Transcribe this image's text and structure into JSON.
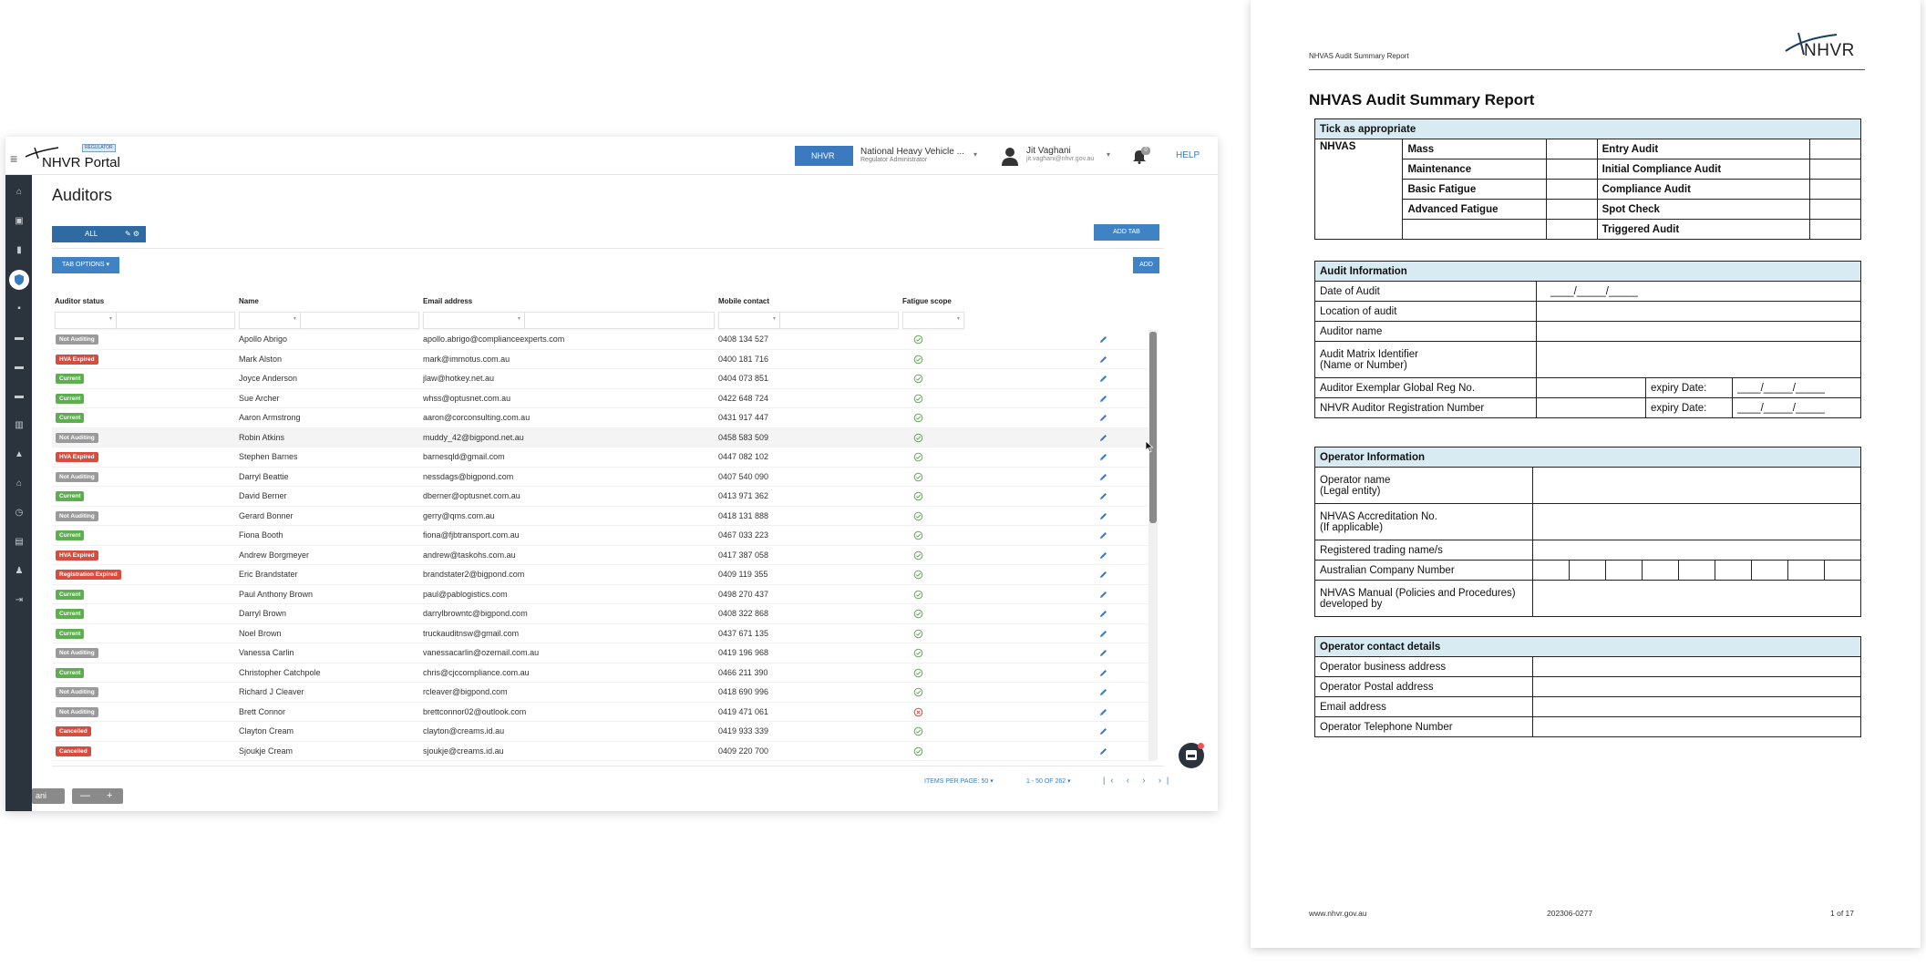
{
  "app": {
    "logo_text": "NHVR Portal",
    "logo_badge": "REGULATOR",
    "org_name": "National Heavy Vehicle ...",
    "org_role": "Regulator Administrator",
    "org_logo_text": "NHVR",
    "user_name": "Jit Vaghani",
    "user_email": "jit.vaghani@nhvr.gov.au",
    "notification_count": "0",
    "help_label": "HELP"
  },
  "page": {
    "title": "Auditors",
    "tab_all_label": "ALL",
    "add_tab_label": "ADD TAB",
    "tab_options_label": "TAB OPTIONS ▾",
    "add_label": "ADD"
  },
  "table": {
    "columns": [
      "Auditor status",
      "Name",
      "Email address",
      "Mobile contact",
      "Fatigue scope"
    ],
    "rows": [
      {
        "status": "Not Auditing",
        "name": "Apollo Abrigo",
        "email": "apollo.abrigo@complianceexperts.com",
        "mobile": "0408 134 527",
        "fatigue": "ok"
      },
      {
        "status": "HVA Expired",
        "name": "Mark Alston",
        "email": "mark@immotus.com.au",
        "mobile": "0400 181 716",
        "fatigue": "ok"
      },
      {
        "status": "Current",
        "name": "Joyce Anderson",
        "email": "jlaw@hotkey.net.au",
        "mobile": "0404 073 851",
        "fatigue": "ok"
      },
      {
        "status": "Current",
        "name": "Sue Archer",
        "email": "whss@optusnet.com.au",
        "mobile": "0422 648 724",
        "fatigue": "ok"
      },
      {
        "status": "Current",
        "name": "Aaron Armstrong",
        "email": "aaron@corconsulting.com.au",
        "mobile": "0431 917 447",
        "fatigue": "ok"
      },
      {
        "status": "Not Auditing",
        "name": "Robin Atkins",
        "email": "muddy_42@bigpond.net.au",
        "mobile": "0458 583 509",
        "fatigue": "ok"
      },
      {
        "status": "HVA Expired",
        "name": "Stephen Barnes",
        "email": "barnesqld@gmail.com",
        "mobile": "0447 082 102",
        "fatigue": "ok"
      },
      {
        "status": "Not Auditing",
        "name": "Darryl Beattie",
        "email": "nessdags@bigpond.com",
        "mobile": "0407 540 090",
        "fatigue": "ok"
      },
      {
        "status": "Current",
        "name": "David Berner",
        "email": "dberner@optusnet.com.au",
        "mobile": "0413 971 362",
        "fatigue": "ok"
      },
      {
        "status": "Not Auditing",
        "name": "Gerard Bonner",
        "email": "gerry@qms.com.au",
        "mobile": "0418 131 888",
        "fatigue": "ok"
      },
      {
        "status": "Current",
        "name": "Fiona Booth",
        "email": "fiona@fjbtransport.com.au",
        "mobile": "0467 033 223",
        "fatigue": "ok"
      },
      {
        "status": "HVA Expired",
        "name": "Andrew Borgmeyer",
        "email": "andrew@taskohs.com.au",
        "mobile": "0417 387 058",
        "fatigue": "ok"
      },
      {
        "status": "Registration Expired",
        "name": "Eric Brandstater",
        "email": "brandstater2@bigpond.com",
        "mobile": "0409 119 355",
        "fatigue": "ok"
      },
      {
        "status": "Current",
        "name": "Paul Anthony Brown",
        "email": "paul@pablogistics.com",
        "mobile": "0498 270 437",
        "fatigue": "ok"
      },
      {
        "status": "Current",
        "name": "Darryl Brown",
        "email": "darrylbrowntc@bigpond.com",
        "mobile": "0408 322 868",
        "fatigue": "ok"
      },
      {
        "status": "Current",
        "name": "Noel Brown",
        "email": "truckauditnsw@gmail.com",
        "mobile": "0437 671 135",
        "fatigue": "ok"
      },
      {
        "status": "Not Auditing",
        "name": "Vanessa Carlin",
        "email": "vanessacarlin@ozemail.com.au",
        "mobile": "0419 196 968",
        "fatigue": "ok"
      },
      {
        "status": "Current",
        "name": "Christopher Catchpole",
        "email": "chris@cjccompliance.com.au",
        "mobile": "0466 211 390",
        "fatigue": "ok"
      },
      {
        "status": "Not Auditing",
        "name": "Richard J Cleaver",
        "email": "rcleaver@bigpond.com",
        "mobile": "0418 690 996",
        "fatigue": "ok"
      },
      {
        "status": "Not Auditing",
        "name": "Brett Connor",
        "email": "brettconnor02@outlook.com",
        "mobile": "0419 471 061",
        "fatigue": "no"
      },
      {
        "status": "Cancelled",
        "name": "Clayton Cream",
        "email": "clayton@creams.id.au",
        "mobile": "0419 933 339",
        "fatigue": "ok"
      },
      {
        "status": "Cancelled",
        "name": "Sjoukje Cream",
        "email": "sjoukje@creams.id.au",
        "mobile": "0409 220 700",
        "fatigue": "ok"
      }
    ],
    "highlighted_row": 5,
    "items_per_page": "ITEMS PER PAGE: 50 ▾",
    "range": "1 - 50 OF 262 ▾",
    "pager": "|‹ ‹ › ›|"
  },
  "status_colors": {
    "Not Auditing": "#9a9a9a",
    "HVA Expired": "#d94b3d",
    "Current": "#5cae4f",
    "Registration Expired": "#d94b3d",
    "Cancelled": "#d94b3d"
  },
  "icons": {
    "fatigue_ok": "check-circle-icon",
    "fatigue_no": "cross-circle-icon",
    "edit": "pencil-icon"
  },
  "taskbar": {
    "name": "ani",
    "zoom_out": "—",
    "zoom_in": "+"
  },
  "report": {
    "header_text": "NHVAS Audit Summary Report",
    "logo_text": "NHVR",
    "title": "NHVAS Audit Summary Report",
    "tick": {
      "heading": "Tick as appropriate",
      "label": "NHVAS",
      "modules": [
        "Mass",
        "Maintenance",
        "Basic Fatigue",
        "Advanced Fatigue",
        ""
      ],
      "audit_types": [
        "Entry Audit",
        "Initial Compliance Audit",
        "Compliance Audit",
        "Spot Check",
        "Triggered Audit"
      ]
    },
    "audit_info": {
      "heading": "Audit Information",
      "date_label": "Date of Audit",
      "date_placeholder": "____/_____/_____",
      "location_label": "Location of audit",
      "auditor_label": "Auditor name",
      "matrix_label_1": "Audit Matrix Identifier",
      "matrix_label_2": "(Name or Number)",
      "exemplar_label": "Auditor Exemplar Global Reg No.",
      "registration_label": "NHVR Auditor Registration Number",
      "expiry_label": "expiry Date:",
      "expiry_placeholder": "____/_____/_____"
    },
    "operator_info": {
      "heading": "Operator Information",
      "name_label_1": "Operator name",
      "name_label_2": "(Legal entity)",
      "accred_label_1": "NHVAS Accreditation No.",
      "accred_label_2": "(If applicable)",
      "trading_label": "Registered trading name/s",
      "acn_label": "Australian Company Number",
      "manual_label_1": "NHVAS Manual (Policies and Procedures)",
      "manual_label_2": "developed by"
    },
    "contact": {
      "heading": "Operator contact details",
      "business_label": "Operator business address",
      "postal_label": "Operator Postal address",
      "email_label": "Email address",
      "phone_label": "Operator Telephone Number"
    },
    "footer_left": "www.nhvr.gov.au",
    "footer_center": "202306-0277",
    "footer_right": "1 of 17"
  }
}
